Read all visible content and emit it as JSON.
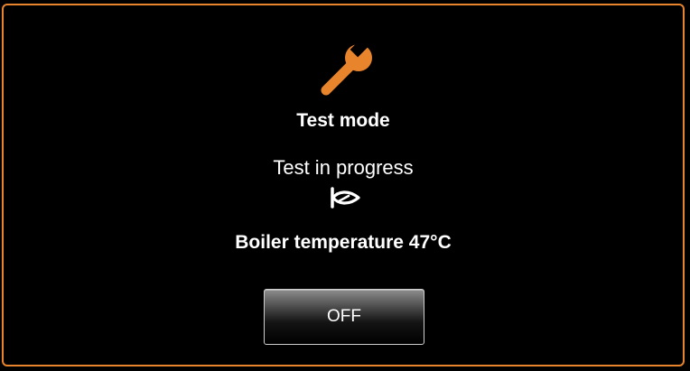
{
  "dialog": {
    "title": "Test mode",
    "status": "Test in progress",
    "boiler_temperature": "Boiler temperature 47°C",
    "off_button_label": "OFF"
  },
  "icons": {
    "header": "wrench-icon",
    "status": "burner-flame-icon"
  },
  "colors": {
    "accent": "#e8842c",
    "background": "#000000",
    "text": "#ffffff"
  }
}
